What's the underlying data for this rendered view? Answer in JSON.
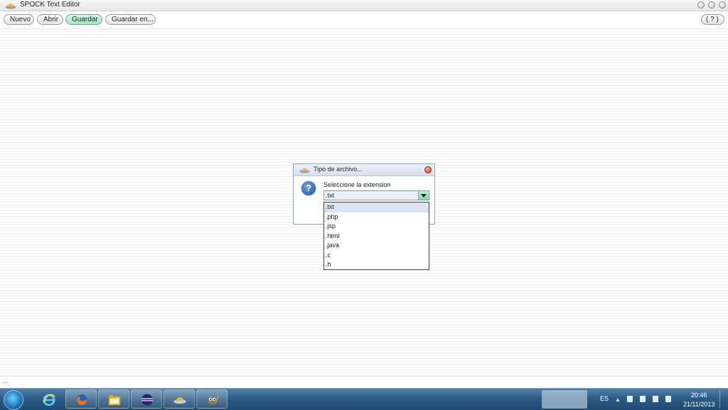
{
  "window": {
    "title": "SPOCK Text Editor"
  },
  "toolbar": {
    "new_label": "Nuevo",
    "open_label": "Abrir",
    "save_label": "Guardar",
    "save_as_label": "Guardar en...",
    "help_label": "( ? )"
  },
  "editor": {
    "footer_text": "..."
  },
  "dialog": {
    "title": "Tipo de archivo...",
    "prompt": "Seleccione la extension",
    "selected": ".txt",
    "options": [
      ".txt",
      ".php",
      ".jsp",
      ".html",
      ".java",
      ".c",
      ".h"
    ]
  },
  "taskbar": {
    "apps": [
      "internet-explorer",
      "firefox",
      "file-explorer",
      "eclipse",
      "spock-editor",
      "gimp"
    ],
    "language": "ES",
    "time": "20:46",
    "date": "21/11/2013"
  },
  "colors": {
    "active_button": "#a8e3c3",
    "taskbar": "#2a5a84",
    "dialog_header": "#d7dfee",
    "close_button": "#d2311f"
  }
}
